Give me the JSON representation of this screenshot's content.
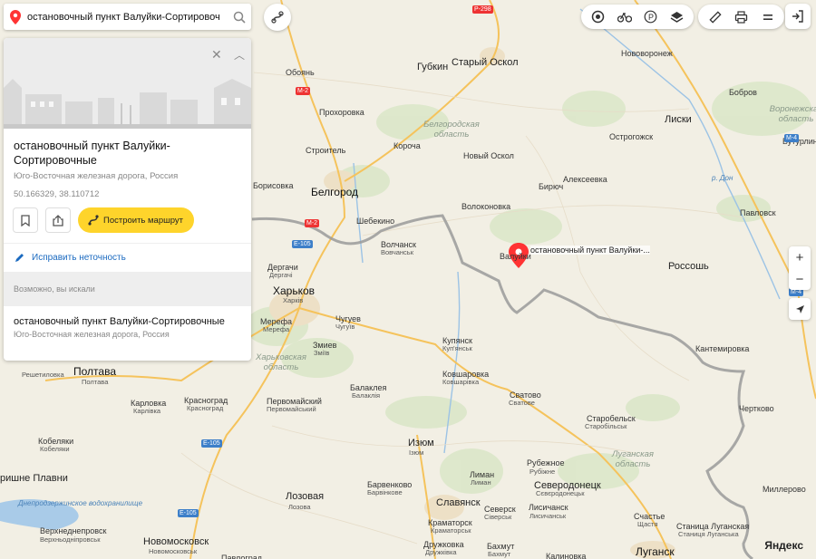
{
  "search": {
    "value": "остановочный пункт Валуйки-Сортировоч"
  },
  "card": {
    "title": "остановочный пункт Валуйки-Сортировочные",
    "address": "Юго-Восточная железная дорога, Россия",
    "coords": "50.166329, 38.110712",
    "route_label": "Построить маршрут",
    "fix_label": "Исправить неточность",
    "maybe_label": "Возможно, вы искали",
    "suggestion_title": "остановочный пункт Валуйки-Сортировочные",
    "suggestion_address": "Юго-Восточная железная дорога, Россия"
  },
  "poi_label": "остановочный пункт Валуйки-...",
  "logo": "Яндекс",
  "zoom": {
    "in": "+",
    "out": "−"
  },
  "map_labels": {
    "starosk": "Старый Оскол",
    "gubkin": "Губкин",
    "oboyan": "Обоянь",
    "prohorovka": "Прохоровка",
    "stroitel": "Строитель",
    "korocha": "Короча",
    "noskol": "Новый Оскол",
    "belgorod": "Белгород",
    "borisovka": "Борисовка",
    "shebekino": "Шебекино",
    "volokonovka": "Волоконовка",
    "biryuch": "Бирюч",
    "alekseevka": "Алексеевка",
    "ostrogozhsk": "Острогожск",
    "liski": "Лиски",
    "bobrov": "Бобров",
    "buturlin": "Бутурлиновка",
    "pavlovsk": "Павловск",
    "rossosh": "Россошь",
    "novovoronezh": "Нововоронеж",
    "valuyki": "Валуйки",
    "kantem": "Кантемировка",
    "chertkovo": "Чертково",
    "millerovo": "Миллерово",
    "volchansk": "Волчанск",
    "volchansk_ua": "Вовчанськ",
    "dergachi": "Дергачи",
    "dergachi_ua": "Дергачі",
    "kharkov": "Харьков",
    "kharkov_ua": "Харків",
    "merefa": "Мерефа",
    "merefa_ua": "Мерефа",
    "chuguev": "Чугуев",
    "chuguev_ua": "Чугуїв",
    "zmiev": "Змиев",
    "zmiev_ua": "Зміїв",
    "kupyansk": "Купянск",
    "kupyansk_ua": "Куп'янськ",
    "borovaya": "Ковшаровка",
    "borovaya_ua": "Ковшарівка",
    "balakleya": "Балаклея",
    "balakleya_ua": "Балаклія",
    "svatovo": "Сватово",
    "svatovo_ua": "Сватове",
    "starobelsk": "Старобельск",
    "starobelsk_ua": "Старобільськ",
    "poltava": "Полтава",
    "poltava_ua": "Полтава",
    "reshetilovka": "Решетиловка",
    "karlovka": "Карловка",
    "karlovka_ua": "Карлівка",
    "krasnograd": "Красноград",
    "krasnograd_ua": "Красноград",
    "pervomaisky": "Первомайский",
    "pervomaisky_ua": "Первомайський",
    "izyum": "Изюм",
    "izyum_ua": "Ізюм",
    "kobeliaki": "Кобеляки",
    "kobeliaki_ua": "Кобеляки",
    "lozovaya": "Лозовая",
    "lozovaya_ua": "Лозова",
    "barvenkovo": "Барвенково",
    "barvenkovo_ua": "Барвінкове",
    "liman": "Лиман",
    "liman_ua": "Лиман",
    "rubezhnoe": "Рубежное",
    "rubezhnoe_ua": "Рубіжне",
    "severodonetsk": "Северодонецк",
    "severodonetsk_ua": "Сєвєродонецьк",
    "slavyansk": "Славянск",
    "seversk": "Северск",
    "seversk_ua": "Сіверськ",
    "lisichansk": "Лисичанск",
    "lisichansk_ua": "Лисичанськ",
    "kramatorsk": "Краматорск",
    "kramatorsk_ua": "Краматорськ",
    "druzhkovka": "Дружковка",
    "druzhkovka_ua": "Дружківка",
    "bakhmut": "Бахмут",
    "bakhmut_ua": "Бахмут",
    "kalinovka": "Калиновка",
    "lugansk": "Луганск",
    "schastye": "Счастье",
    "schastye_ua": "Щастя",
    "stanitsa": "Станица Луганская",
    "stanitsa_ua": "Станиця Луганська",
    "novomoskovsk": "Новомосковск",
    "novomoskovsk_ua": "Новомосковськ",
    "verkhnedn": "Верхнеднепровск",
    "verkhnedn_ua": "Верхньодніпровськ",
    "plavni": "ришне Плавни",
    "dnepr_res": "Днепродзержинское водохранилище",
    "pervograd": "Павлоград",
    "region_belg": "Белгородская область",
    "region_khar": "Харьковская область",
    "region_lug": "Луганская область",
    "region_vor": "Воронежская область",
    "river_don": "р. Дон"
  },
  "road_labels": {
    "p298": "Р-298",
    "m2": "М-2",
    "m2b": "М-2",
    "e105": "E-105",
    "e105b": "E-105",
    "e105c": "E-105",
    "m4": "М-4",
    "m4b": "М-4"
  }
}
